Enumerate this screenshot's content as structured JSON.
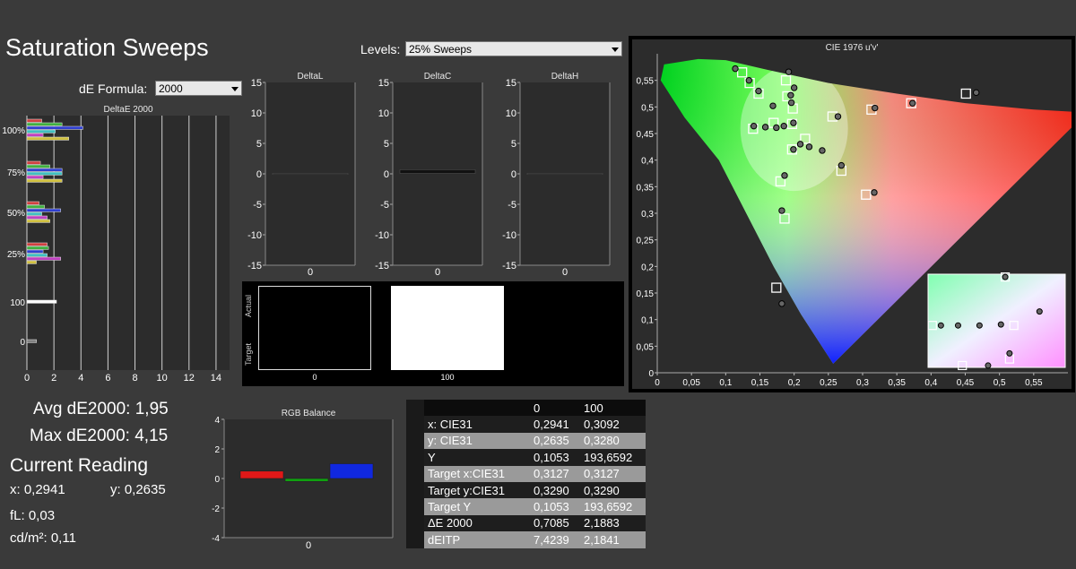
{
  "page_title": "Saturation Sweeps",
  "levels": {
    "label": "Levels:",
    "value": "25% Sweeps"
  },
  "de_formula": {
    "label": "dE Formula:",
    "value": "2000"
  },
  "stats": {
    "avg": "Avg dE2000: 1,95",
    "max": "Max dE2000: 4,15",
    "current_reading": "Current Reading",
    "x": "x: 0,2941",
    "y": "y: 0,2635",
    "fl": "fL: 0,03",
    "cdm2": "cd/m²: 0,11"
  },
  "table": {
    "headers": [
      "",
      "0",
      "100"
    ],
    "rows": [
      [
        "x: CIE31",
        "0,2941",
        "0,3092"
      ],
      [
        "y: CIE31",
        "0,2635",
        "0,3280"
      ],
      [
        "Y",
        "0,1053",
        "193,6592"
      ],
      [
        "Target x:CIE31",
        "0,3127",
        "0,3127"
      ],
      [
        "Target y:CIE31",
        "0,3290",
        "0,3290"
      ],
      [
        "Target Y",
        "0,1053",
        "193,6592"
      ],
      [
        "ΔE 2000",
        "0,7085",
        "2,1883"
      ],
      [
        "dEITP",
        "7,4239",
        "2,1841"
      ]
    ]
  },
  "swatches": {
    "actual_label": "Actual",
    "target_label": "Target",
    "labels": [
      "0",
      "100"
    ],
    "colors": [
      "#000000",
      "#ffffff"
    ]
  },
  "chart_data": [
    {
      "type": "bar",
      "title": "DeltaE 2000",
      "orientation": "horizontal",
      "xlim": [
        0,
        15
      ],
      "xticks": [
        "0",
        "2",
        "4",
        "6",
        "8",
        "10",
        "12",
        "14"
      ],
      "groups": [
        {
          "label": "100%",
          "bars": [
            {
              "color": "#d04040",
              "value": 1.1
            },
            {
              "color": "#40b040",
              "value": 2.6
            },
            {
              "color": "#3040d0",
              "value": 4.15
            },
            {
              "color": "#40c0c0",
              "value": 2.1
            },
            {
              "color": "#c040c0",
              "value": 1.2
            },
            {
              "color": "#d0c040",
              "value": 3.1
            }
          ]
        },
        {
          "label": "75%",
          "bars": [
            {
              "color": "#d04040",
              "value": 1.0
            },
            {
              "color": "#40b040",
              "value": 1.7
            },
            {
              "color": "#3040d0",
              "value": 2.6
            },
            {
              "color": "#40c0c0",
              "value": 2.6
            },
            {
              "color": "#c040c0",
              "value": 1.2
            },
            {
              "color": "#d0c040",
              "value": 2.6
            }
          ]
        },
        {
          "label": "50%",
          "bars": [
            {
              "color": "#d04040",
              "value": 0.9
            },
            {
              "color": "#40b040",
              "value": 1.3
            },
            {
              "color": "#3040d0",
              "value": 2.5
            },
            {
              "color": "#40c0c0",
              "value": 1.1
            },
            {
              "color": "#c040c0",
              "value": 1.5
            },
            {
              "color": "#d0c040",
              "value": 1.7
            }
          ]
        },
        {
          "label": "25%",
          "bars": [
            {
              "color": "#d04040",
              "value": 1.5
            },
            {
              "color": "#40b040",
              "value": 1.6
            },
            {
              "color": "#3040d0",
              "value": 1.2
            },
            {
              "color": "#40c0c0",
              "value": 1.5
            },
            {
              "color": "#c040c0",
              "value": 2.5
            },
            {
              "color": "#d0c040",
              "value": 0.7
            }
          ]
        },
        {
          "label": "100",
          "bars": [
            {
              "color": "#ffffff",
              "value": 2.19
            }
          ]
        },
        {
          "label": "0",
          "bars": [
            {
              "color": "#808080",
              "value": 0.71
            }
          ]
        }
      ]
    },
    {
      "type": "bar",
      "title": "DeltaL",
      "categories": [
        "0"
      ],
      "values": [
        0
      ],
      "ylim": [
        -15,
        15
      ],
      "yticks": [
        "15",
        "10",
        "5",
        "0",
        "-5",
        "-10",
        "-15"
      ]
    },
    {
      "type": "bar",
      "title": "DeltaC",
      "categories": [
        "0"
      ],
      "values": [
        0.6
      ],
      "ylim": [
        -15,
        15
      ],
      "yticks": [
        "15",
        "10",
        "5",
        "0",
        "-5",
        "-10",
        "-15"
      ]
    },
    {
      "type": "bar",
      "title": "DeltaH",
      "categories": [
        "0"
      ],
      "values": [
        0
      ],
      "ylim": [
        -15,
        15
      ],
      "yticks": [
        "15",
        "10",
        "5",
        "0",
        "-5",
        "-10",
        "-15"
      ]
    },
    {
      "type": "bar",
      "title": "RGB Balance",
      "categories": [
        "0"
      ],
      "series": [
        {
          "color": "#e01818",
          "values": [
            0.5
          ]
        },
        {
          "color": "#10a010",
          "values": [
            -0.2
          ]
        },
        {
          "color": "#1028e0",
          "values": [
            1.0
          ]
        }
      ],
      "ylim": [
        -4,
        4
      ],
      "yticks": [
        "4",
        "2",
        "0",
        "-2",
        "-4"
      ]
    },
    {
      "type": "scatter",
      "title": "CIE 1976 u'v'",
      "xlim": [
        0,
        0.6
      ],
      "ylim": [
        0,
        0.6
      ],
      "xticks": [
        "0",
        "0,05",
        "0,1",
        "0,15",
        "0,2",
        "0,25",
        "0,3",
        "0,35",
        "0,4",
        "0,45",
        "0,5",
        "0,55"
      ],
      "yticks": [
        "0",
        "0,05",
        "0,1",
        "0,15",
        "0,2",
        "0,25",
        "0,3",
        "0,35",
        "0,4",
        "0,45",
        "0,5",
        "0,55"
      ],
      "targets": [
        [
          0.124,
          0.565
        ],
        [
          0.135,
          0.545
        ],
        [
          0.148,
          0.525
        ],
        [
          0.17,
          0.47
        ],
        [
          0.14,
          0.459
        ],
        [
          0.188,
          0.55
        ],
        [
          0.19,
          0.52
        ],
        [
          0.198,
          0.497
        ],
        [
          0.197,
          0.42
        ],
        [
          0.216,
          0.44
        ],
        [
          0.256,
          0.482
        ],
        [
          0.313,
          0.495
        ],
        [
          0.371,
          0.507
        ],
        [
          0.451,
          0.525
        ],
        [
          0.18,
          0.36
        ],
        [
          0.186,
          0.29
        ],
        [
          0.174,
          0.16
        ],
        [
          0.269,
          0.38
        ],
        [
          0.305,
          0.335
        ],
        [
          0.197,
          0.468
        ]
      ],
      "measured": [
        [
          0.114,
          0.572
        ],
        [
          0.134,
          0.55
        ],
        [
          0.148,
          0.53
        ],
        [
          0.169,
          0.502
        ],
        [
          0.141,
          0.464
        ],
        [
          0.158,
          0.462
        ],
        [
          0.174,
          0.461
        ],
        [
          0.185,
          0.464
        ],
        [
          0.192,
          0.566
        ],
        [
          0.2,
          0.536
        ],
        [
          0.195,
          0.522
        ],
        [
          0.196,
          0.508
        ],
        [
          0.199,
          0.47
        ],
        [
          0.209,
          0.43
        ],
        [
          0.199,
          0.42
        ],
        [
          0.222,
          0.425
        ],
        [
          0.241,
          0.418
        ],
        [
          0.264,
          0.482
        ],
        [
          0.318,
          0.498
        ],
        [
          0.373,
          0.507
        ],
        [
          0.466,
          0.527
        ],
        [
          0.186,
          0.371
        ],
        [
          0.182,
          0.305
        ],
        [
          0.182,
          0.13
        ],
        [
          0.269,
          0.39
        ],
        [
          0.317,
          0.339
        ]
      ]
    }
  ]
}
